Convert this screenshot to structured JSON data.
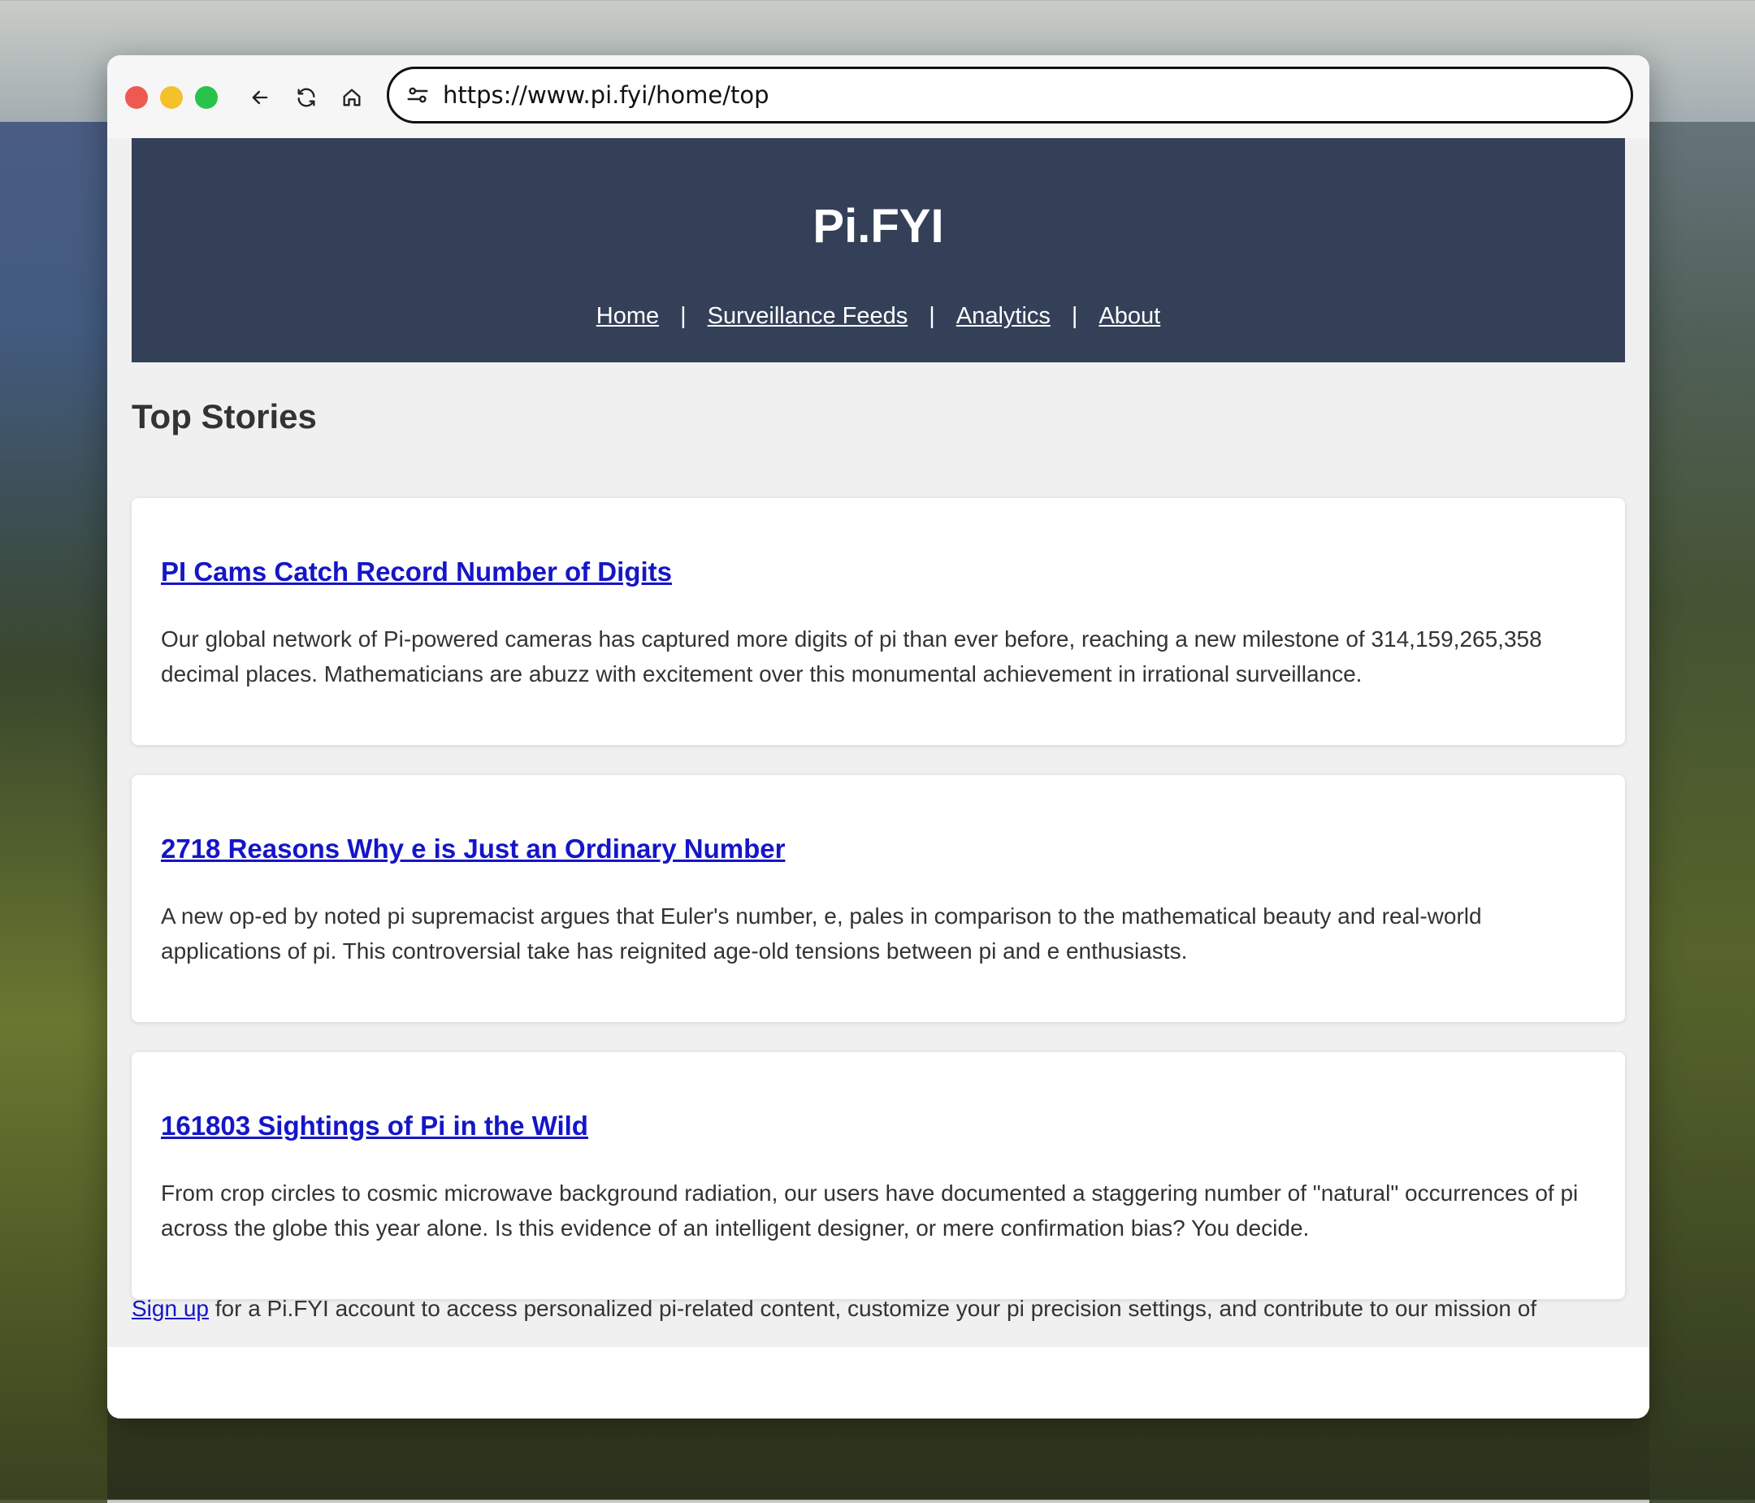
{
  "browser": {
    "url": "https://www.pi.fyi/home/top",
    "back_icon": "arrow-left-icon",
    "reload_icon": "reload-icon",
    "home_icon": "home-icon",
    "site_settings_icon": "site-settings-icon"
  },
  "site": {
    "title": "Pi.FYI",
    "nav": [
      {
        "label": "Home"
      },
      {
        "label": "Surveillance Feeds"
      },
      {
        "label": "Analytics"
      },
      {
        "label": "About"
      }
    ],
    "separator": "|"
  },
  "main": {
    "section_title": "Top Stories",
    "stories": [
      {
        "title": "PI Cams Catch Record Number of Digits",
        "body": "Our global network of Pi-powered cameras has captured more digits of pi than ever before, reaching a new milestone of 314,159,265,358 decimal places. Mathematicians are abuzz with excitement over this monumental achievement in irrational surveillance."
      },
      {
        "title": "2718 Reasons Why e is Just an Ordinary Number",
        "body": "A new op-ed by noted pi supremacist argues that Euler's number, e, pales in comparison to the mathematical beauty and real-world applications of pi. This controversial take has reignited age-old tensions between pi and e enthusiasts."
      },
      {
        "title": "161803 Sightings of Pi in the Wild",
        "body": "From crop circles to cosmic microwave background radiation, our users have documented a staggering number of \"natural\" occurrences of pi across the globe this year alone. Is this evidence of an intelligent designer, or mere confirmation bias? You decide."
      }
    ],
    "signup": {
      "link": "Sign up",
      "text": " for a Pi.FYI account to access personalized pi-related content, customize your pi precision settings, and contribute to our mission of"
    }
  },
  "colors": {
    "header_bg": "#344058",
    "link": "#1515c8",
    "page_bg": "#f0f0f0"
  }
}
